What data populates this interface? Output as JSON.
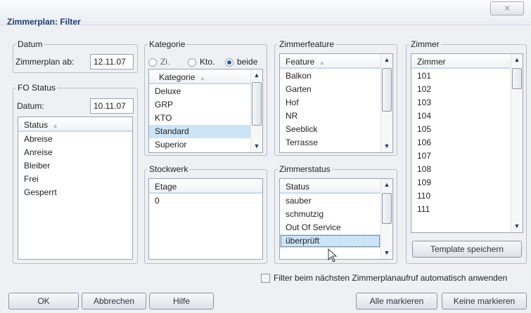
{
  "window": {
    "title": "Zimmerplan: Filter",
    "close_glyph": "⨯"
  },
  "datum": {
    "legend": "Datum",
    "label": "Zimmerplan ab:",
    "value": "12.11.07"
  },
  "fo_status": {
    "legend": "FO Status",
    "datum_label": "Datum:",
    "datum_value": "10.11.07",
    "header": "Status",
    "items": [
      "Abreise",
      "Anreise",
      "Bleiber",
      "Frei",
      "Gesperrt"
    ]
  },
  "kategorie": {
    "legend": "Kategorie",
    "radio_zi": "Zi.",
    "radio_kto": "Kto.",
    "radio_beide": "beide",
    "selected_radio": "beide",
    "header": "Kategorie",
    "items": [
      "Deluxe",
      "GRP",
      "KTO",
      "Standard",
      "Superior"
    ],
    "selected": "Standard"
  },
  "stockwerk": {
    "legend": "Stockwerk",
    "header": "Etage",
    "items": [
      "0"
    ]
  },
  "zimmerfeature": {
    "legend": "Zimmerfeature",
    "header": "Feature",
    "items": [
      "Balkon",
      "Garten",
      "Hof",
      "NR",
      "Seeblick",
      "Terrasse"
    ]
  },
  "zimmerstatus": {
    "legend": "Zimmerstatus",
    "header": "Status",
    "items": [
      "sauber",
      "schmutzig",
      "Out Of Service",
      "überprüft"
    ],
    "selected": "überprüft"
  },
  "zimmer": {
    "legend": "Zimmer",
    "header": "Zimmer",
    "items": [
      "101",
      "102",
      "103",
      "104",
      "105",
      "106",
      "107",
      "108",
      "109",
      "110",
      "111"
    ],
    "template_button": "Template speichern"
  },
  "auto_apply": {
    "label": "Filter beim nächsten Zimmerplanaufruf automatisch anwenden",
    "checked": false
  },
  "buttons": {
    "ok": "OK",
    "abbrechen": "Abbrechen",
    "hilfe": "Hilfe",
    "alle_markieren": "Alle markieren",
    "keine_markieren": "Keine markieren"
  },
  "icons": {
    "sort": "sort-ascending-icon",
    "up": "scroll-up-arrow-icon",
    "down": "scroll-down-arrow-icon",
    "close": "close-icon",
    "cursor": "mouse-pointer-icon"
  }
}
